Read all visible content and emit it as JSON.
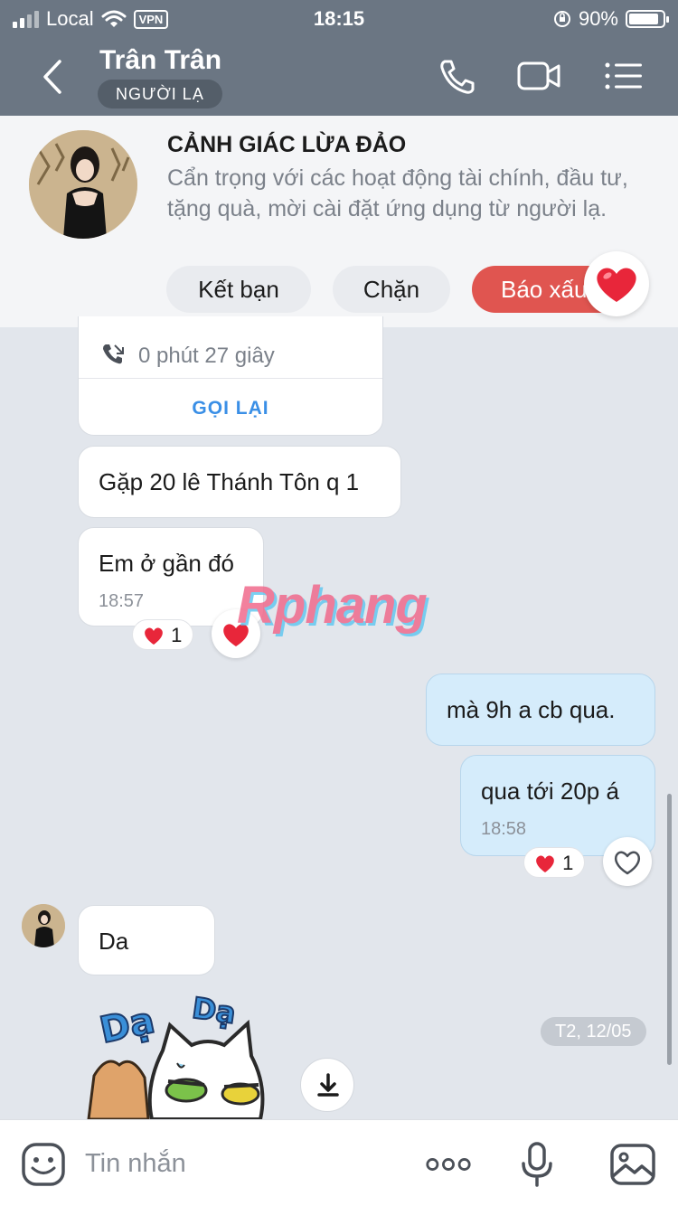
{
  "status_bar": {
    "carrier": "Local",
    "vpn": "VPN",
    "time": "18:15",
    "battery": "90%",
    "battery_level": 0.9
  },
  "header": {
    "contact_name": "Trân Trân",
    "tag": "NGƯỜI LẠ",
    "icons": [
      "back-icon",
      "phone-icon",
      "video-icon",
      "menu-icon"
    ]
  },
  "warning": {
    "title": "CẢNH GIÁC LỪA ĐẢO",
    "text": "Cẩn trọng với các hoạt động tài chính, đầu tư, tặng quà, mời cài đặt ứng dụng từ người lạ.",
    "add_friend": "Kết bạn",
    "block": "Chặn",
    "report": "Báo xấu"
  },
  "messages": {
    "call_duration": "0 phút 27 giây",
    "call_back": "GỌI LẠI",
    "m1_text": "Gặp 20 lê Thánh Tôn q 1",
    "m2_text": "Em ở gần đó",
    "m2_time": "18:57",
    "m2_reaction_count": "1",
    "m3_text": "mà 9h a cb qua.",
    "m4_text": "qua tới 20p á",
    "m4_time": "18:58",
    "m4_reaction_count": "1",
    "m5_text": "Da",
    "sticker_text_1": "Dạ",
    "sticker_text_2": "Dạ",
    "date_chip": "T2, 12/05"
  },
  "watermark": "Rphang",
  "input": {
    "placeholder": "Tin nhắn"
  },
  "colors": {
    "header_bg": "#6b7683",
    "report_red": "#e05550",
    "link_blue": "#3a8fe6",
    "my_bubble": "#d5ecfb",
    "heart": "#e8263a"
  }
}
